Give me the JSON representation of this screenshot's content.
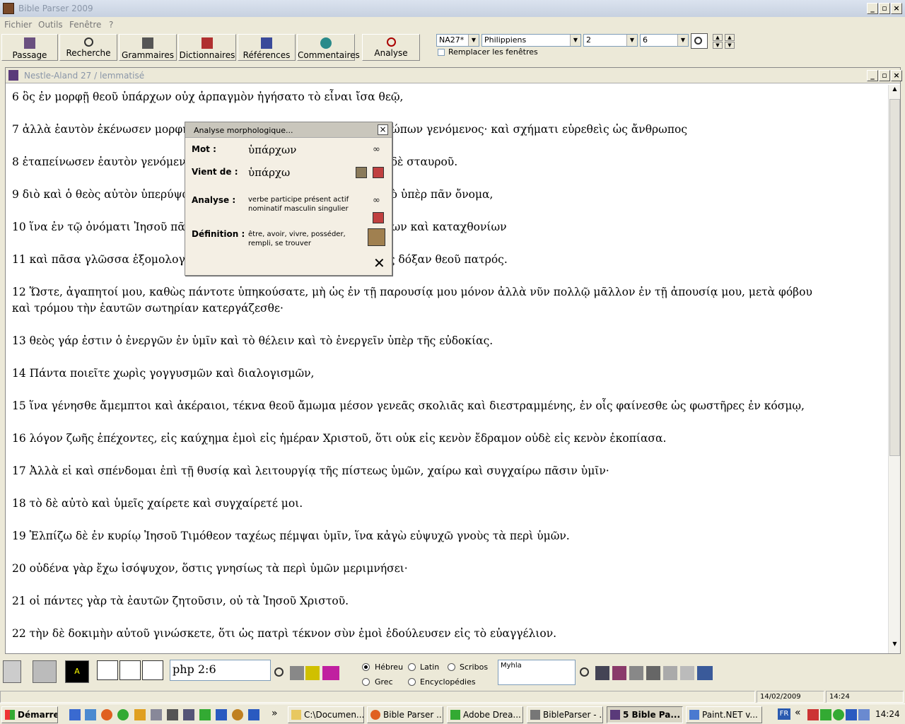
{
  "app": {
    "title": "Bible Parser 2009"
  },
  "menu": [
    "Fichier",
    "Outils",
    "Fenêtre",
    "?"
  ],
  "toolbar": {
    "buttons": [
      "Passage",
      "Recherche",
      "Grammaires",
      "Dictionnaires",
      "Références",
      "Commentaires",
      "Analyse"
    ],
    "version": "NA27*",
    "book": "Philippiens",
    "chapter": "2",
    "verse": "6",
    "replace_windows": "Remplacer les fenêtres"
  },
  "doc": {
    "title": "Nestle-Aland 27 / lemmatisé",
    "verses": [
      "6 ὃς ἐν μορφῇ θεοῦ ὑπάρχων οὐχ ἁρπαγμὸν ἡγήσατο τὸ εἶναι ἴσα θεῷ,",
      "7 ἀλλὰ ἑαυτὸν ἐκένωσεν μορφὴν δούλου λαβών, ἐν ὁμοιώματι ἀνθρώπων γενόμενος· καὶ σχήματι εὑρεθεὶς ὡς ἄνθρωπος",
      "8 ἐταπείνωσεν ἑαυτὸν γενόμενος ὑπήκοος μέχρι θανάτου, θανάτου δὲ σταυροῦ.",
      "9 διὸ καὶ ὁ θεὸς αὐτὸν ὑπερύψωσεν καὶ ἐχαρίσατο αὐτῷ τὸ ὄνομα τὸ ὑπὲρ πᾶν ὄνομα,",
      "10 ἵνα ἐν τῷ ὀνόματι Ἰησοῦ πᾶν γόνυ κάμψῃ ἐπουρανίων καὶ ἐπιγείων καὶ καταχθονίων",
      "11 καὶ πᾶσα γλῶσσα ἐξομολογήσηται ὅτι κύριος Ἰησοῦς Χριστὸς εἰς δόξαν θεοῦ πατρός.",
      "12 Ὥστε, ἀγαπητοί μου, καθὼς πάντοτε ὑπηκούσατε, μὴ ὡς ἐν τῇ παρουσίᾳ μου μόνον ἀλλὰ νῦν πολλῷ μᾶλλον ἐν τῇ ἀπουσίᾳ μου, μετὰ φόβου",
      "καὶ τρόμου τὴν ἑαυτῶν σωτηρίαν κατεργάζεσθε·",
      "13 θεὸς γάρ ἐστιν ὁ ἐνεργῶν ἐν ὑμῖν καὶ τὸ θέλειν καὶ τὸ ἐνεργεῖν ὑπὲρ τῆς εὐδοκίας.",
      "14 Πάντα ποιεῖτε χωρὶς γογγυσμῶν καὶ διαλογισμῶν,",
      "15 ἵνα γένησθε ἄμεμπτοι καὶ ἀκέραιοι, τέκνα θεοῦ ἄμωμα μέσον γενεᾶς σκολιᾶς καὶ διεστραμμένης, ἐν οἷς φαίνεσθε ὡς φωστῆρες ἐν κόσμῳ,",
      "16 λόγον ζωῆς ἐπέχοντες, εἰς καύχημα ἐμοὶ εἰς ἡμέραν Χριστοῦ, ὅτι οὐκ εἰς κενὸν ἔδραμον οὐδὲ εἰς κενὸν ἐκοπίασα.",
      "17 Ἀλλὰ εἰ καὶ σπένδομαι ἐπὶ τῇ θυσίᾳ καὶ λειτουργίᾳ τῆς πίστεως ὑμῶν, χαίρω καὶ συγχαίρω πᾶσιν ὑμῖν·",
      "18 τὸ δὲ αὐτὸ καὶ ὑμεῖς χαίρετε καὶ συγχαίρετέ μοι.",
      "19 Ἐλπίζω δὲ ἐν κυρίῳ Ἰησοῦ Τιμόθεον ταχέως πέμψαι ὑμῖν, ἵνα κἀγὼ εὐψυχῶ γνοὺς τὰ περὶ ὑμῶν.",
      "20 οὐδένα γὰρ ἔχω ἰσόψυχον, ὅστις γνησίως τὰ περὶ ὑμῶν μεριμνήσει·",
      "21 οἱ πάντες γὰρ τὰ ἑαυτῶν ζητοῦσιν, οὐ τὰ Ἰησοῦ Χριστοῦ.",
      "22 τὴν δὲ δοκιμὴν αὐτοῦ γινώσκετε, ὅτι ὡς πατρὶ τέκνον σὺν ἐμοὶ ἐδούλευσεν εἰς τὸ εὐαγγέλιον."
    ]
  },
  "popup": {
    "title": "Analyse morphologique...",
    "mot_label": "Mot :",
    "mot": "ὑπάρχων",
    "vient_label": "Vient de :",
    "vient": "ὑπάρχω",
    "analyse_label": "Analyse :",
    "analyse": "verbe participe présent actif nominatif masculin singulier",
    "def_label": "Définition :",
    "definition": "être, avoir, vivre, posséder, rempli, se trouver"
  },
  "bottom": {
    "ref_input": "php 2:6",
    "radios": [
      "Hébreu",
      "Latin",
      "Scribos",
      "Grec",
      "Encyclopédies"
    ],
    "selected_radio": "Hébreu",
    "text_field": "Myhla"
  },
  "status": {
    "date": "14/02/2009",
    "time": "14:24"
  },
  "taskbar": {
    "start": "Démarrer",
    "tasks": [
      "C:\\Documen...",
      "Bible Parser ...",
      "Adobe Drea...",
      "BibleParser - ...",
      "5 Bible Pa...",
      "Paint.NET v..."
    ],
    "lang": "FR",
    "clock": "14:24"
  },
  "colors": {
    "accent": "#316ac5",
    "desktop": "#ece9d8"
  }
}
